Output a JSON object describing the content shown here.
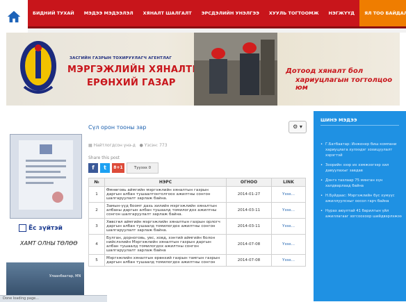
{
  "nav": {
    "items": [
      {
        "label": "БИДНИЙ ТУХАЙ",
        "active": false
      },
      {
        "label": "МЭДЭЭ МЭДЭЭЛЭЛ",
        "active": false
      },
      {
        "label": "ХЯНАЛТ ШАЛГАЛТ",
        "active": false
      },
      {
        "label": "ЭРСДЭЛИЙН УНЭЛГЭЭ",
        "active": false
      },
      {
        "label": "ХУУЛЬ ТОГТООМЖ",
        "active": false
      },
      {
        "label": "НЭГЖҮҮД",
        "active": false
      },
      {
        "label": "ЯЛ ТОО БАЙДАЛ",
        "active": true
      }
    ]
  },
  "banner": {
    "agency_small": "ЗАСГИЙН ГАЗРЫН ТОХИРУУЛАГЧ АГЕНТЛАГ",
    "agency_line1": "МЭРГЭЖЛИЙН ХЯНАЛТЫН",
    "agency_line2": "ЕРӨНХИЙ ГАЗАР",
    "slogan_line1": "Дотоод хяналт бол",
    "slogan_line2": "хариуцлагын тогтолцоо юм"
  },
  "left_ads": {
    "title": "Ёс зүйтэй",
    "subtitle": "ХАМТ ОЛНЫ ТӨЛӨӨ",
    "photo_label": "Улаанбаатар, МN"
  },
  "post": {
    "title": "Сүл орон тооны зар",
    "author": "Найтлогдсон үнэ-д",
    "views": "Үзсэн: 773",
    "share_label": "Share this post",
    "tweet_label": "Туузэх",
    "tweet_count": "0",
    "gplus": "8+1"
  },
  "table": {
    "headers": [
      "№",
      "НЭРС",
      "ОГНОО",
      "LINK"
    ],
    "rows": [
      {
        "num": "1",
        "name": "Өмнөговь аймгийн мэргэжлийн хяналтын газрын даргын албан тушаалтонтолгоох ажилтны сонгон шалгаруулалт зарлаж байна.",
        "date": "2014-01-27",
        "link": "Үзэх..."
      },
      {
        "num": "2",
        "name": "Замын-үүд боомт дахь хилийн мэргэжлийн хяналтын албаны даргын албан тушаалд томилогдох ажилтны сонгон шалгаруулалт зарлаж байна.",
        "date": "2014-03-11",
        "link": "Үзэх..."
      },
      {
        "num": "3",
        "name": "Хөвсгөл аймгийн мэргэжлийн хяналтын газрын орлогч даргын албан тушаалд томилогдох ажилтны сонгон шалгаруулалт зарлаж байна.",
        "date": "2014-03-11",
        "link": "Үзэх..."
      },
      {
        "num": "4",
        "name": "Булган, дорноговь, увс, ховд, хэнтий аймгийн болон нийслэлийн Мэргэжлийн хяналтын газрын даргын албан тушаалд томилогдох ажилтны сонгон шалгаруулалт зарлаж байна",
        "date": "2014-07-08",
        "link": "Үзэх..."
      },
      {
        "num": "5",
        "name": "Мэргэжлийн хяналтын ерөнхий газрын тамгын газрын даргын албан тушаалд томилогдох ажилтны сонгон",
        "date": "2014-07-08",
        "link": "Үзэх..."
      }
    ]
  },
  "sidebar": {
    "title": "ШИНЭ МЭДЭЭ",
    "news": [
      "Г.Батбаатар: Инженер биш компани хариуцлага хулээдэг зохицуулалт хэрэгтэй",
      "Зоорийн зээр их хэмжээгээр хил давуулахыг завдав",
      "Дэнгэ тахлаар 75 мянган хүн халдварлаад байна",
      "Н.Буйдаас: Мэргэжлийн бус хүмүүс ажиллуулсныг оосол гарч байна",
      "Нурах аюултай 41 барилгын үйл ажиллагааг зогсоохоор шийдвэрлэжээ"
    ]
  },
  "statusbar": {
    "text": "Done loading page..."
  }
}
